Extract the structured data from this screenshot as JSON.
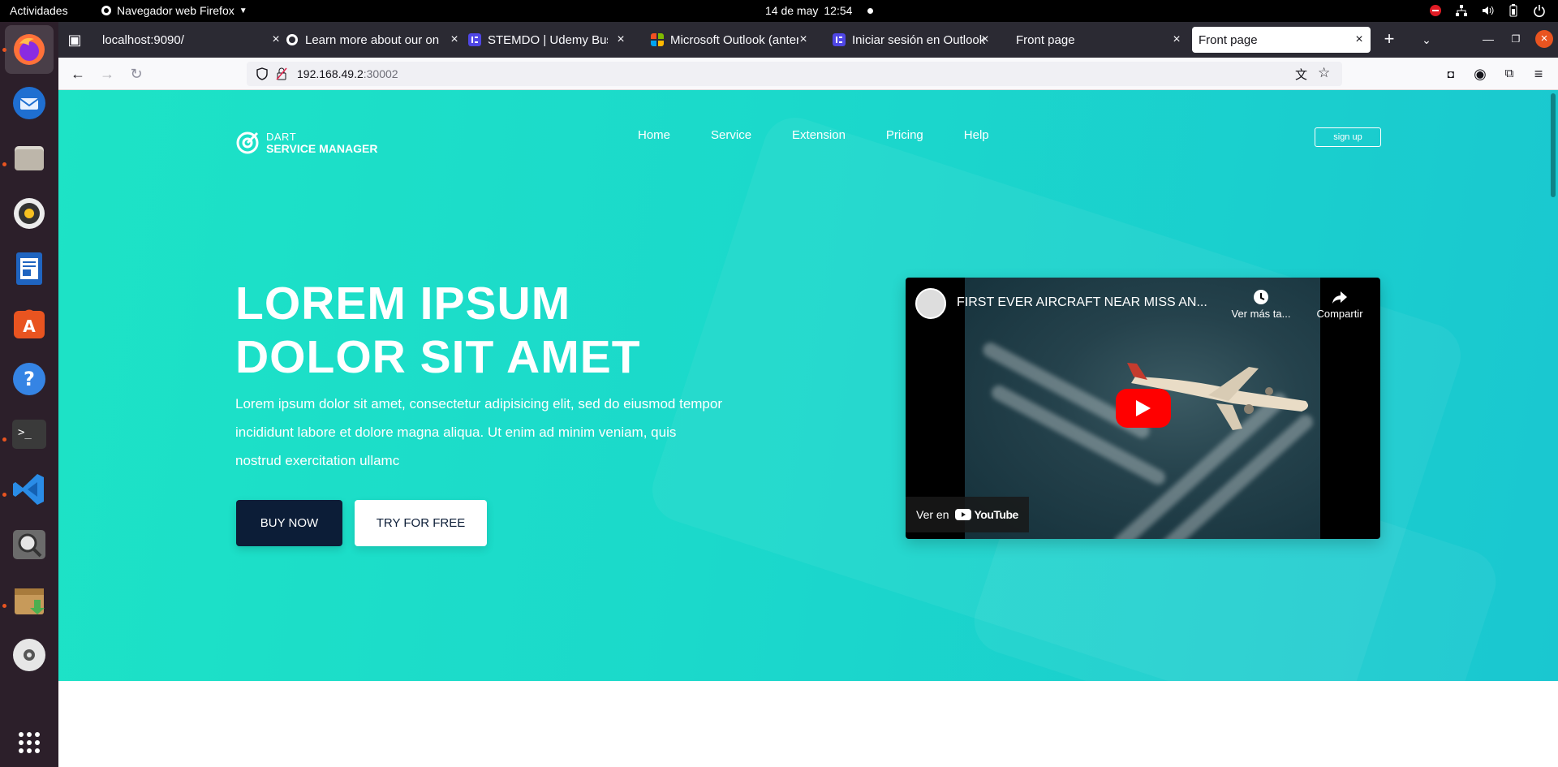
{
  "system": {
    "activities": "Actividades",
    "app_name": "Navegador web Firefox",
    "date": "14 de may",
    "time": "12:54"
  },
  "tabs": [
    {
      "title": "localhost:9090/",
      "favicon": "none"
    },
    {
      "title": "Learn more about our on",
      "favicon": "github-icon"
    },
    {
      "title": "STEMDO | Udemy Busine",
      "favicon": "stemdo-icon"
    },
    {
      "title": "Microsoft Outlook (anter",
      "favicon": "microsoft-icon"
    },
    {
      "title": "Iniciar sesión en Outlook",
      "favicon": "stemdo-icon"
    },
    {
      "title": "Front page",
      "favicon": "none"
    },
    {
      "title": "Front page",
      "favicon": "none",
      "selected": true
    }
  ],
  "url": {
    "host": "192.168.49.2",
    "port": ":30002"
  },
  "site": {
    "logo_small": "DART",
    "logo_big": "SERVICE MANAGER",
    "menu": [
      "Home",
      "Service",
      "Extension",
      "Pricing",
      "Help"
    ],
    "signup": "sign up"
  },
  "hero": {
    "title_line1": "LOREM IPSUM",
    "title_line2": "DOLOR SIT AMET",
    "text": "Lorem ipsum dolor sit amet, consectetur adipisicing elit, sed do eiusmod tempor incididunt labore et dolore magna aliqua. Ut enim ad minim veniam, quis nostrud exercitation ullamc",
    "buy_label": "BUY NOW",
    "try_label": "TRY FOR FREE"
  },
  "video": {
    "title": "FIRST EVER AIRCRAFT NEAR MISS AN...",
    "watch_later": "Ver más ta...",
    "share": "Compartir",
    "watch_on": "Ver en",
    "youtube": "YouTube"
  },
  "colors": {
    "hero_start": "#1de3c6",
    "hero_end": "#1ac7d0",
    "buy_button": "#0c1d37",
    "dock_bg": "#2c1f2a"
  }
}
